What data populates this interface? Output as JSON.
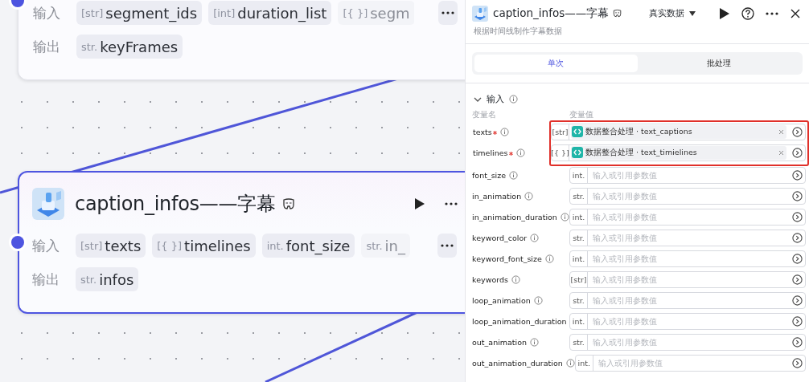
{
  "canvas": {
    "nodes": [
      {
        "rows": [
          {
            "label": "输入",
            "params": [
              {
                "type": "[str]",
                "name": "segment_ids",
                "faded": false
              },
              {
                "type": "[int]",
                "name": "duration_list",
                "faded": false
              },
              {
                "type": "[{ }]",
                "name": "segm",
                "faded": true
              }
            ],
            "more": true
          },
          {
            "label": "输出",
            "params": [
              {
                "type": "str.",
                "name": "keyFrames",
                "faded": false
              }
            ],
            "more": false
          }
        ]
      },
      {
        "title": "caption_infos——字幕",
        "rows": [
          {
            "label": "输入",
            "params": [
              {
                "type": "[str]",
                "name": "texts",
                "faded": false
              },
              {
                "type": "[{ }]",
                "name": "timelines",
                "faded": false
              },
              {
                "type": "int.",
                "name": "font_size",
                "faded": false
              },
              {
                "type": "str.",
                "name": "in_",
                "faded": true
              }
            ],
            "more": true
          },
          {
            "label": "输出",
            "params": [
              {
                "type": "str.",
                "name": "infos",
                "faded": false
              }
            ],
            "more": false
          }
        ]
      }
    ]
  },
  "panel": {
    "title": "caption_infos——字幕",
    "data_source": "真实数据",
    "description": "根据时间线制作字幕数据",
    "tabs": [
      {
        "label": "单次",
        "selected": true
      },
      {
        "label": "批处理",
        "selected": false
      }
    ],
    "section": {
      "title": "输入",
      "expanded": true,
      "columns": [
        "变量名",
        "变量值"
      ],
      "rows": [
        {
          "name": "texts",
          "required": true,
          "info": true,
          "type": "[str]",
          "highlighted": true,
          "value": "数据整合处理 · text_captions"
        },
        {
          "name": "timelines",
          "required": true,
          "info": true,
          "type": "[{ }]",
          "highlighted": true,
          "value": "数据整合处理 · text_timielines"
        },
        {
          "name": "font_size",
          "required": false,
          "info": true,
          "type": "int.",
          "highlighted": false,
          "placeholder": "输入或引用参数值"
        },
        {
          "name": "in_animation",
          "required": false,
          "info": true,
          "type": "str.",
          "highlighted": false,
          "placeholder": "输入或引用参数值"
        },
        {
          "name": "in_animation_duration",
          "required": false,
          "info": true,
          "type": "int.",
          "highlighted": false,
          "placeholder": "输入或引用参数值"
        },
        {
          "name": "keyword_color",
          "required": false,
          "info": true,
          "type": "str.",
          "highlighted": false,
          "placeholder": "输入或引用参数值"
        },
        {
          "name": "keyword_font_size",
          "required": false,
          "info": true,
          "type": "int.",
          "highlighted": false,
          "placeholder": "输入或引用参数值"
        },
        {
          "name": "keywords",
          "required": false,
          "info": true,
          "type": "[str]",
          "highlighted": false,
          "placeholder": "输入或引用参数值"
        },
        {
          "name": "loop_animation",
          "required": false,
          "info": true,
          "type": "str.",
          "highlighted": false,
          "placeholder": "输入或引用参数值"
        },
        {
          "name": "loop_animation_duration",
          "required": false,
          "info": false,
          "type": "int.",
          "highlighted": false,
          "placeholder": "输入或引用参数值"
        },
        {
          "name": "out_animation",
          "required": false,
          "info": true,
          "type": "str.",
          "highlighted": false,
          "placeholder": "输入或引用参数值"
        },
        {
          "name": "out_animation_duration",
          "required": false,
          "info": true,
          "type": "int.",
          "highlighted": false,
          "placeholder": "输入或引用参数值"
        }
      ]
    }
  }
}
